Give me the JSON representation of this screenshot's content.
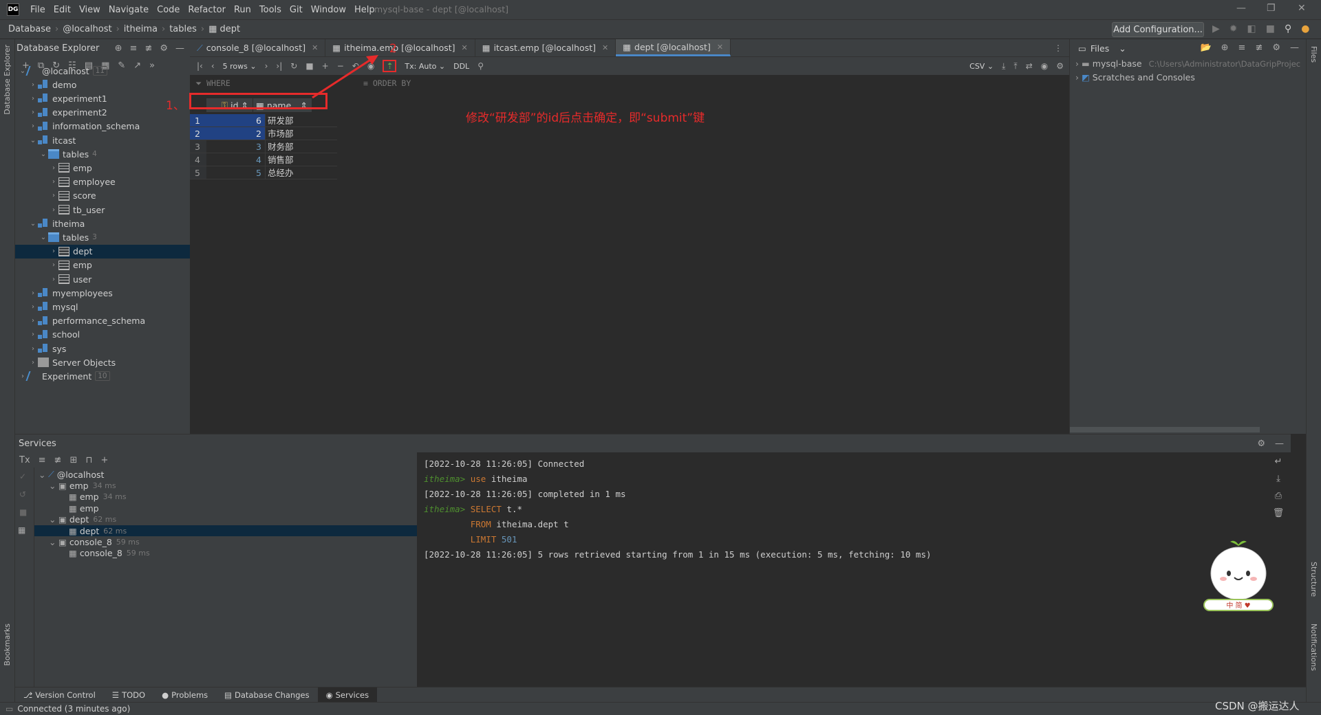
{
  "window": {
    "title": "mysql-base - dept [@localhost]",
    "logo": "DG"
  },
  "menu": [
    "File",
    "Edit",
    "View",
    "Navigate",
    "Code",
    "Refactor",
    "Run",
    "Tools",
    "Git",
    "Window",
    "Help"
  ],
  "breadcrumb": [
    "Database",
    "@localhost",
    "itheima",
    "tables",
    "dept"
  ],
  "toolbar": {
    "add_configuration": "Add Configuration..."
  },
  "db_explorer": {
    "title": "Database Explorer",
    "tree": [
      {
        "label": "@localhost",
        "count": "11",
        "type": "host",
        "depth": 0,
        "open": true
      },
      {
        "label": "demo",
        "type": "db",
        "depth": 1
      },
      {
        "label": "experiment1",
        "type": "db",
        "depth": 1
      },
      {
        "label": "experiment2",
        "type": "db",
        "depth": 1
      },
      {
        "label": "information_schema",
        "type": "db",
        "depth": 1
      },
      {
        "label": "itcast",
        "type": "db",
        "depth": 1,
        "open": true
      },
      {
        "label": "tables",
        "count": "4",
        "type": "folder",
        "depth": 2,
        "open": true
      },
      {
        "label": "emp",
        "type": "table",
        "depth": 3
      },
      {
        "label": "employee",
        "type": "table",
        "depth": 3
      },
      {
        "label": "score",
        "type": "table",
        "depth": 3
      },
      {
        "label": "tb_user",
        "type": "table",
        "depth": 3
      },
      {
        "label": "itheima",
        "type": "db",
        "depth": 1,
        "open": true
      },
      {
        "label": "tables",
        "count": "3",
        "type": "folder",
        "depth": 2,
        "open": true
      },
      {
        "label": "dept",
        "type": "table",
        "depth": 3,
        "selected": true
      },
      {
        "label": "emp",
        "type": "table",
        "depth": 3
      },
      {
        "label": "user",
        "type": "table",
        "depth": 3
      },
      {
        "label": "myemployees",
        "type": "db",
        "depth": 1
      },
      {
        "label": "mysql",
        "type": "db",
        "depth": 1
      },
      {
        "label": "performance_schema",
        "type": "db",
        "depth": 1
      },
      {
        "label": "school",
        "type": "db",
        "depth": 1
      },
      {
        "label": "sys",
        "type": "db",
        "depth": 1
      },
      {
        "label": "Server Objects",
        "type": "srv",
        "depth": 1
      },
      {
        "label": "Experiment",
        "count": "10",
        "type": "host",
        "depth": 0
      }
    ]
  },
  "tabs": [
    {
      "label": "console_8 [@localhost]",
      "active": false
    },
    {
      "label": "itheima.emp [@localhost]",
      "active": false
    },
    {
      "label": "itcast.emp [@localhost]",
      "active": false
    },
    {
      "label": "dept [@localhost]",
      "active": true
    }
  ],
  "grid_toolbar": {
    "rows": "5 rows",
    "tx": "Tx: Auto",
    "ddl": "DDL",
    "export": "CSV"
  },
  "filter": {
    "where": "WHERE",
    "order_by": "ORDER BY"
  },
  "grid": {
    "columns": [
      "id",
      "name"
    ],
    "rows": [
      {
        "n": "1",
        "id": "6",
        "name": "研发部",
        "sel": true
      },
      {
        "n": "2",
        "id": "2",
        "name": "市场部",
        "sel": true
      },
      {
        "n": "3",
        "id": "3",
        "name": "财务部",
        "sel": false
      },
      {
        "n": "4",
        "id": "4",
        "name": "销售部",
        "sel": false
      },
      {
        "n": "5",
        "id": "5",
        "name": "总经办",
        "sel": false
      }
    ]
  },
  "annotations": {
    "step1": "1、",
    "step2": "2",
    "note": "修改“研发部”的id后点击确定，即“submit”键",
    "color": "#e62b2b"
  },
  "files_panel": {
    "title": "Files",
    "project": "mysql-base",
    "project_path": "C:\\Users\\Administrator\\DataGripProjec",
    "scratches": "Scratches and Consoles"
  },
  "left_strip": {
    "db_explorer": "Database Explorer",
    "bookmarks": "Bookmarks"
  },
  "right_strip": {
    "files": "Files",
    "structure": "Structure",
    "notifications": "Notifications"
  },
  "services": {
    "title": "Services",
    "tree": [
      {
        "label": "@localhost",
        "ms": "",
        "depth": 0
      },
      {
        "label": "emp",
        "ms": "34 ms",
        "depth": 1
      },
      {
        "label": "emp",
        "ms": "34 ms",
        "depth": 2
      },
      {
        "label": "emp",
        "ms": "",
        "depth": 2
      },
      {
        "label": "dept",
        "ms": "62 ms",
        "depth": 1
      },
      {
        "label": "dept",
        "ms": "62 ms",
        "depth": 2,
        "selected": true
      },
      {
        "label": "console_8",
        "ms": "59 ms",
        "depth": 1
      },
      {
        "label": "console_8",
        "ms": "59 ms",
        "depth": 2
      }
    ],
    "console": {
      "l1": "[2022-10-28 11:26:05] Connected",
      "l2p": "itheima>",
      "l2": "use itheima",
      "l3": "[2022-10-28 11:26:05] completed in 1 ms",
      "l4p": "itheima>",
      "l4a": "SELECT",
      "l4b": "t.*",
      "l5a": "FROM",
      "l5b": "itheima.dept t",
      "l6a": "LIMIT",
      "l6b": "501",
      "l7": "[2022-10-28 11:26:05] 5 rows retrieved starting from 1 in 15 ms (execution: 5 ms, fetching: 10 ms)"
    }
  },
  "bottom_tabs": [
    "Version Control",
    "TODO",
    "Problems",
    "Database Changes",
    "Services"
  ],
  "status": "Connected (3 minutes ago)",
  "watermark": "CSDN @搬运达人",
  "mascot_text": "中 简 ♥"
}
